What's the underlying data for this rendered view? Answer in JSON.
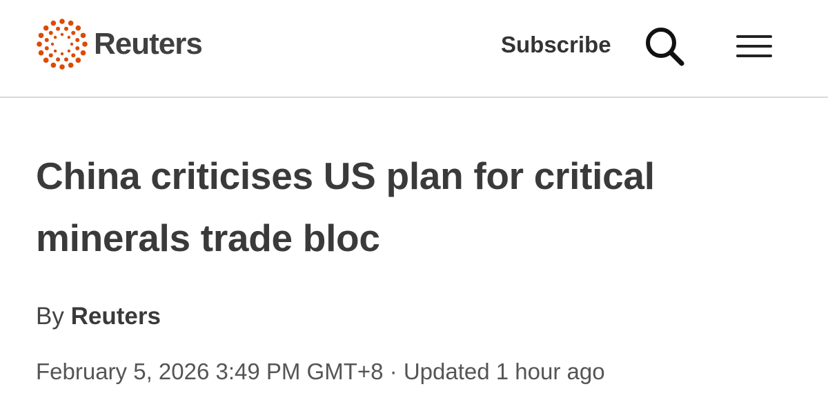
{
  "header": {
    "brand_name": "Reuters",
    "brand_color": "#dc4a00",
    "subscribe_label": "Subscribe",
    "search_icon": "search-icon",
    "menu_icon": "hamburger-menu-icon"
  },
  "article": {
    "headline": "China criticises US plan for critical minerals trade bloc",
    "byline_prefix": "By",
    "author": "Reuters",
    "published": "February 5, 2026 3:49 PM GMT+8",
    "separator": "·",
    "updated": "Updated 1 hour ago"
  }
}
